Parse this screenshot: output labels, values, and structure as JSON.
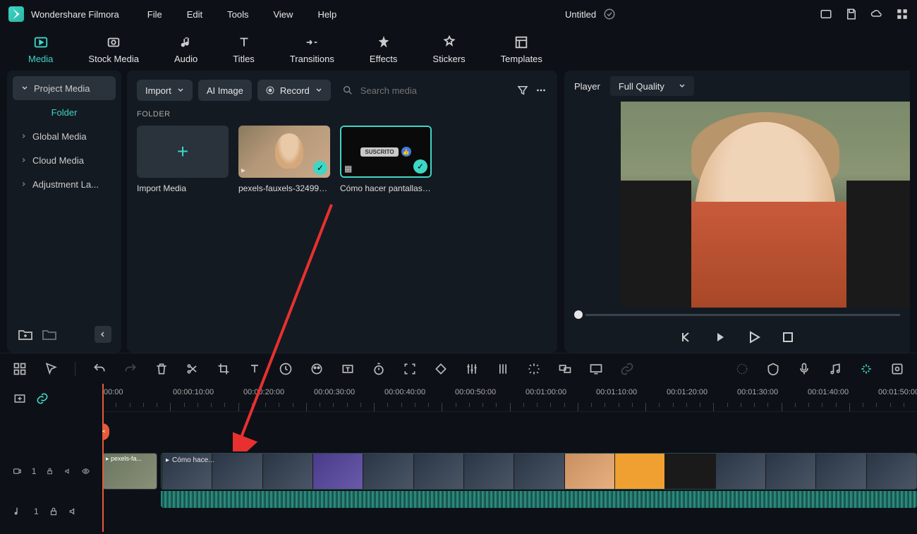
{
  "app": {
    "name": "Wondershare Filmora",
    "title": "Untitled"
  },
  "menu": {
    "file": "File",
    "edit": "Edit",
    "tools": "Tools",
    "view": "View",
    "help": "Help"
  },
  "tabs": {
    "media": "Media",
    "stock": "Stock Media",
    "audio": "Audio",
    "titles": "Titles",
    "transitions": "Transitions",
    "effects": "Effects",
    "stickers": "Stickers",
    "templates": "Templates"
  },
  "sidebar": {
    "project": "Project Media",
    "folder": "Folder",
    "global": "Global Media",
    "cloud": "Cloud Media",
    "adjustment": "Adjustment La..."
  },
  "contentbar": {
    "import": "Import",
    "aiimage": "AI Image",
    "record": "Record",
    "search_ph": "Search media"
  },
  "folder_label": "FOLDER",
  "thumbs": {
    "import": "Import Media",
    "pexels": "pexels-fauxels-324993...",
    "como": "Cómo hacer pantallas ...",
    "suscrito_chip": "SUSCRITO"
  },
  "player": {
    "label": "Player",
    "quality": "Full Quality"
  },
  "timeline": {
    "ticks": [
      "00:00",
      "00:00:10:00",
      "00:00:20:00",
      "00:00:30:00",
      "00:00:40:00",
      "00:00:50:00",
      "00:01:00:00",
      "00:01:10:00",
      "00:01:20:00",
      "00:01:30:00",
      "00:01:40:00",
      "00:01:50:00"
    ],
    "clip1_label": "pexels-fa...",
    "clip2_label": "Cómo hace...",
    "video_track": "1",
    "audio_track": "1"
  }
}
